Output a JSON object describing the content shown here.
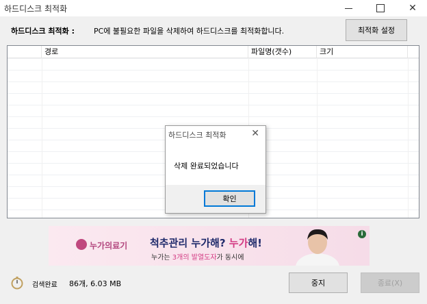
{
  "window": {
    "title": "하드디스크 최적화",
    "close_glyph": "✕"
  },
  "header": {
    "label": "하드디스크 최적화 :",
    "description": "PC에 불필요한 파일을 삭제하여 하드디스크를 최적화합니다.",
    "settings_button": "최적화 설정"
  },
  "table": {
    "columns": [
      "",
      "경로",
      "파일명(갯수)",
      "크기"
    ],
    "rows": []
  },
  "dialog": {
    "title": "하드디스크 최적화",
    "message": "삭제 완료되었습니다",
    "ok_button": "확인",
    "close_glyph": "✕"
  },
  "ad": {
    "brand": "누가의료기",
    "headline_prefix": "척추관리 누가해?",
    "headline_brand": "누가",
    "headline_suffix": "해!",
    "sub_prefix": "누가는",
    "sub_highlight": "3개의 발열도자",
    "sub_suffix": "가 동시에",
    "info_glyph": "i"
  },
  "status": {
    "label": "검색완료",
    "count": "86개, 6.03 MB"
  },
  "footer": {
    "stop_button": "중지",
    "exit_button": "종료(X)"
  },
  "colors": {
    "accent": "#0078d7",
    "ad_pink": "#d33c84",
    "ad_navy": "#1f2a6b"
  }
}
